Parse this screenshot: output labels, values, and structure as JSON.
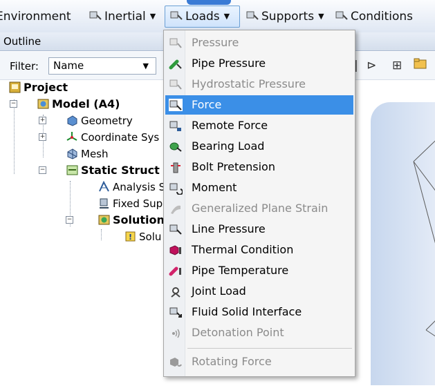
{
  "toolbar": {
    "environment": "Environment",
    "inertial": "Inertial",
    "loads": "Loads",
    "supports": "Supports",
    "conditions": "Conditions"
  },
  "outline": {
    "title": "Outline",
    "filter_label": "Filter:",
    "filter_value": "Name"
  },
  "tree": {
    "project": "Project",
    "model": "Model (A4)",
    "geometry": "Geometry",
    "coordinate_systems": "Coordinate Sys",
    "mesh": "Mesh",
    "static_structural": "Static Struct",
    "analysis_settings": "Analysis S",
    "fixed_support": "Fixed Sup",
    "solution": "Solution",
    "solution_info": "Solu"
  },
  "loads_menu": {
    "items": [
      {
        "label": "Pressure",
        "enabled": false,
        "icon": "pressure-icon"
      },
      {
        "label": "Pipe Pressure",
        "enabled": true,
        "icon": "pipe-pressure-icon"
      },
      {
        "label": "Hydrostatic Pressure",
        "enabled": false,
        "icon": "hydrostatic-pressure-icon"
      },
      {
        "label": "Force",
        "enabled": true,
        "selected": true,
        "icon": "force-icon"
      },
      {
        "label": "Remote Force",
        "enabled": true,
        "icon": "remote-force-icon"
      },
      {
        "label": "Bearing Load",
        "enabled": true,
        "icon": "bearing-load-icon"
      },
      {
        "label": "Bolt Pretension",
        "enabled": true,
        "icon": "bolt-pretension-icon"
      },
      {
        "label": "Moment",
        "enabled": true,
        "icon": "moment-icon"
      },
      {
        "label": "Generalized Plane Strain",
        "enabled": false,
        "icon": "plane-strain-icon"
      },
      {
        "label": "Line Pressure",
        "enabled": true,
        "icon": "line-pressure-icon"
      },
      {
        "label": "Thermal Condition",
        "enabled": true,
        "icon": "thermal-condition-icon"
      },
      {
        "label": "Pipe Temperature",
        "enabled": true,
        "icon": "pipe-temperature-icon"
      },
      {
        "label": "Joint Load",
        "enabled": true,
        "icon": "joint-load-icon"
      },
      {
        "label": "Fluid Solid Interface",
        "enabled": true,
        "icon": "fluid-solid-interface-icon"
      },
      {
        "label": "Detonation Point",
        "enabled": false,
        "icon": "detonation-point-icon"
      },
      {
        "label": "Rotating Force",
        "enabled": false,
        "icon": "rotating-force-icon"
      }
    ]
  },
  "colors": {
    "menu_selection": "#3b8fe7",
    "disabled_text": "#8b8b8b",
    "toolbar_active_border": "#6a9fd4"
  }
}
